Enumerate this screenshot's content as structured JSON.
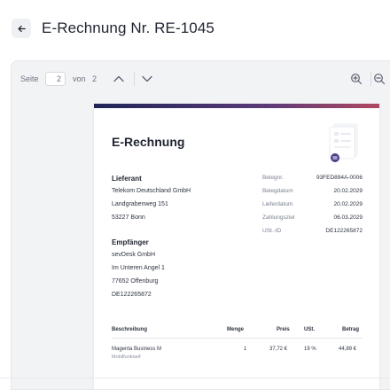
{
  "header": {
    "title": "E-Rechnung Nr. RE-1045"
  },
  "toolbar": {
    "page_label": "Seite",
    "current_page": "2",
    "of_label": "von",
    "total_pages": "2"
  },
  "document": {
    "title": "E-Rechnung",
    "supplier": {
      "heading": "Lieferant",
      "lines": [
        "Telekom Deutschland GmbH",
        "Landgrabenweg 151",
        "53227 Bonn"
      ]
    },
    "recipient": {
      "heading": "Empfänger",
      "lines": [
        "sevDesk GmbH",
        "Im Unteren Angel 1",
        "77652 Offenburg",
        "DE122265872"
      ]
    },
    "meta": [
      {
        "key": "Belegnr.",
        "value": "93FED894A-0006"
      },
      {
        "key": "Belegdatum",
        "value": "20.02.2029"
      },
      {
        "key": "Lieferdatum",
        "value": "20.02.2029"
      },
      {
        "key": "Zahlungsziel",
        "value": "06.03.2029"
      },
      {
        "key": "USt.-ID",
        "value": "DE122265872"
      }
    ],
    "table": {
      "headers": [
        "Beschreibung",
        "Menge",
        "Preis",
        "USt.",
        "Betrag"
      ],
      "rows": [
        {
          "description": "Magenta Business M",
          "subtitle": "Mobilfunktarif",
          "quantity": "1",
          "price": "37,72 €",
          "vat": "19 %",
          "amount": "44,89 €"
        }
      ]
    }
  }
}
